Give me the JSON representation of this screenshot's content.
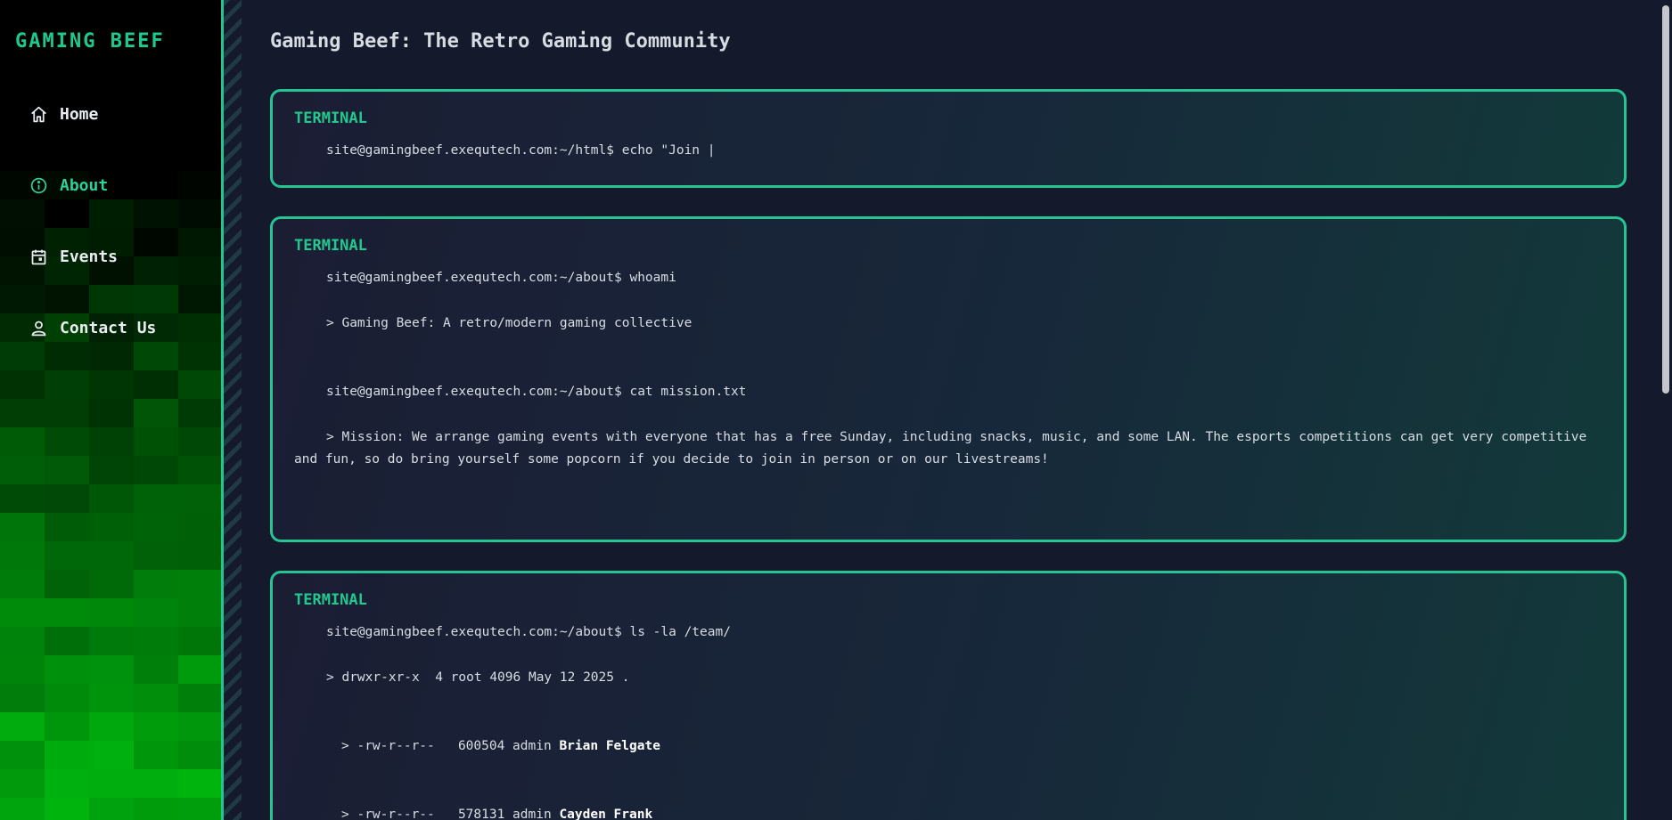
{
  "sidebar": {
    "brand": "GAMING BEEF",
    "items": [
      {
        "label": "Home",
        "icon": "home-icon"
      },
      {
        "label": "About",
        "icon": "info-icon",
        "active": true
      },
      {
        "label": "Events",
        "icon": "calendar-icon"
      },
      {
        "label": "Contact Us",
        "icon": "person-icon"
      }
    ]
  },
  "page": {
    "title": "Gaming Beef: The Retro Gaming Community"
  },
  "terminals": [
    {
      "label": "TERMINAL",
      "prompt": "site@gamingbeef.exequtech.com:~/html$ echo \"Join |"
    },
    {
      "label": "TERMINAL",
      "prompt1": "site@gamingbeef.exequtech.com:~/about$ whoami",
      "output1": "> Gaming Beef: A retro/modern gaming collective",
      "prompt2": "site@gamingbeef.exequtech.com:~/about$ cat mission.txt",
      "output2": "> Mission: We arrange gaming events with everyone that has a free Sunday, including snacks, music, and some LAN. The esports competitions can get very competitive and fun, so do bring yourself some popcorn if you decide to join in person or on our livestreams!"
    },
    {
      "label": "TERMINAL",
      "prompt": "site@gamingbeef.exequtech.com:~/about$ ls -la /team/",
      "dir_line": "> drwxr-xr-x  4 root 4096 May 12 2025 .",
      "members": [
        {
          "perms": "> -rw-r--r--   600504 admin ",
          "name": "Brian Felgate"
        },
        {
          "perms": "> -rw-r--r--   578131 admin ",
          "name": "Cayden Frank"
        }
      ]
    }
  ],
  "colors": {
    "accent": "#27c493",
    "brand": "#1ec98f",
    "background": "#141a2b"
  }
}
